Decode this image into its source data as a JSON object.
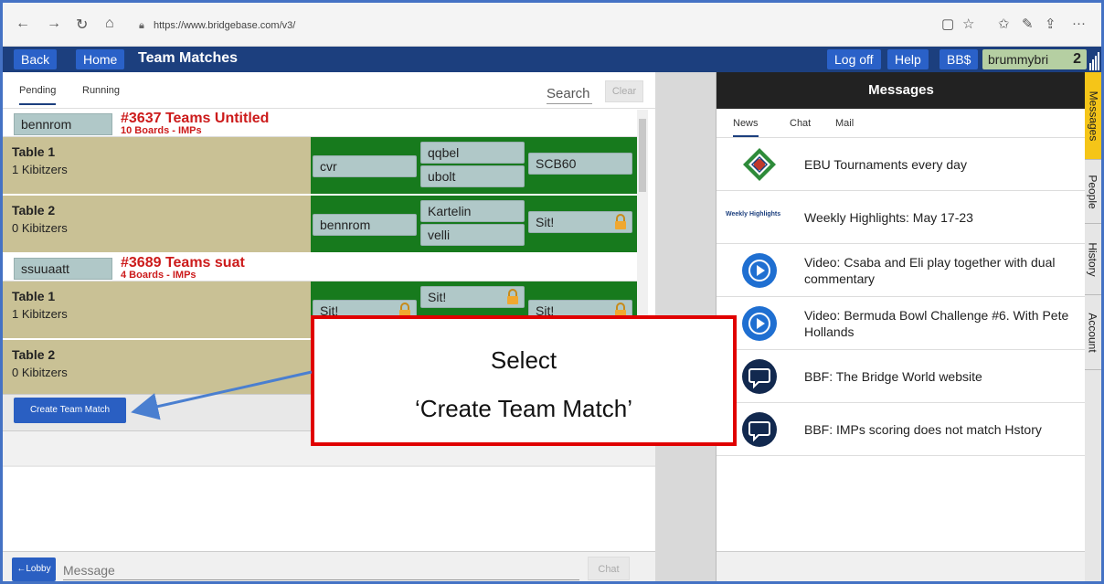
{
  "browser": {
    "url": "https://www.bridgebase.com/v3/"
  },
  "topbar": {
    "back_label": "Back",
    "home_label": "Home",
    "title": "Team Matches",
    "logoff_label": "Log off",
    "help_label": "Help",
    "bbs_label": "BB$",
    "username": "brummybri",
    "user_number": "2"
  },
  "left": {
    "tabs": [
      "Pending",
      "Running"
    ],
    "search_placeholder": "Search",
    "clear_label": "Clear",
    "matches": [
      {
        "captain": "bennrom",
        "title": "#3637 Teams Untitled",
        "subtitle": "10 Boards - IMPs",
        "tables": [
          {
            "name": "Table 1",
            "kibitzers": "1 Kibitzers",
            "north": "qqbel",
            "south": "ubolt",
            "west": "cvr",
            "east": "SCB60"
          },
          {
            "name": "Table 2",
            "kibitzers": "0 Kibitzers",
            "north": "Kartelin",
            "south": "velli",
            "west": "bennrom",
            "east": "Sit!"
          }
        ]
      },
      {
        "captain": "ssuuaatt",
        "title": "#3689 Teams suat",
        "subtitle": "4 Boards - IMPs",
        "tables": [
          {
            "name": "Table 1",
            "kibitzers": "1 Kibitzers",
            "north": "Sit!",
            "west": "Sit!",
            "east": "Sit!"
          },
          {
            "name": "Table 2",
            "kibitzers": "0 Kibitzers"
          }
        ]
      }
    ],
    "create_label": "Create Team Match",
    "lobby_label": "←Lobby",
    "message_placeholder": "Message",
    "chat_label": "Chat"
  },
  "right": {
    "title": "Messages",
    "tabs": [
      "News",
      "Chat",
      "Mail"
    ],
    "news": [
      {
        "text": "EBU Tournaments every day",
        "icon": "ebu-logo-icon"
      },
      {
        "text": "Weekly Highlights: May 17-23",
        "icon": "weekly-highlights-icon",
        "icon_text": "Weekly Highlights"
      },
      {
        "text": "Video: Csaba and Eli play together with dual commentary",
        "icon": "video-play-icon"
      },
      {
        "text": "Video: Bermuda Bowl Challenge #6. With Pete Hollands",
        "icon": "video-play-icon"
      },
      {
        "text": "BBF: The Bridge World website",
        "icon": "chat-bubble-icon"
      },
      {
        "text": "BBF: IMPs scoring does not match Hstory",
        "icon": "chat-bubble-icon"
      }
    ]
  },
  "side_tabs": [
    "Messages",
    "People",
    "History",
    "Account"
  ],
  "callout": {
    "line1": "Select",
    "line2": "‘Create Team Match’"
  },
  "colors": {
    "accent_blue": "#2a61c8",
    "bar_blue": "#1c3f7e",
    "table_green": "#177a1d",
    "table_tan": "#c9c195",
    "title_red": "#cc1b1b",
    "callout_red": "#e00000",
    "active_side_tab": "#f5c518"
  }
}
